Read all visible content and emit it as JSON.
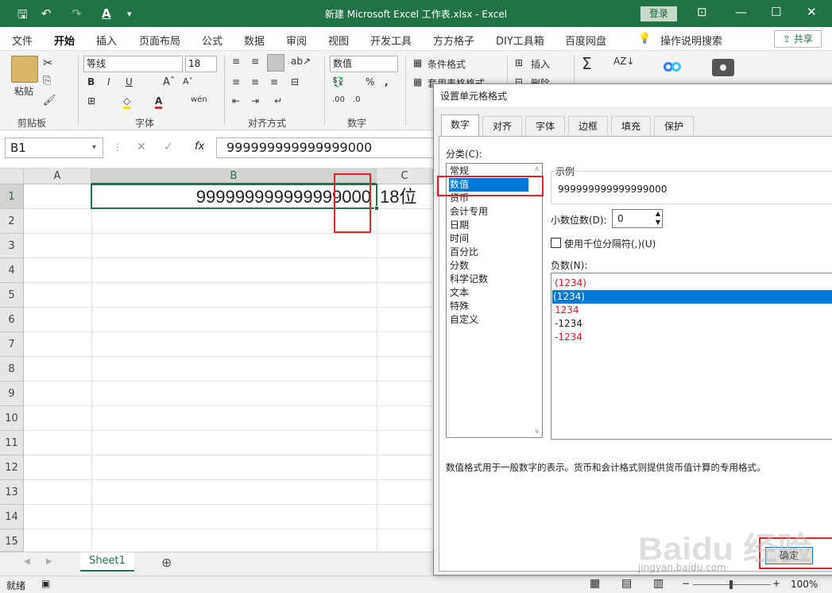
{
  "window": {
    "title": "新建 Microsoft Excel 工作表.xlsx  -  Excel",
    "login": "登录"
  },
  "ribbon_tabs": [
    "文件",
    "开始",
    "插入",
    "页面布局",
    "公式",
    "数据",
    "审阅",
    "视图",
    "开发工具",
    "方方格子",
    "DIY工具箱",
    "百度网盘"
  ],
  "tell_me": "操作说明搜索",
  "share": "共享",
  "ribbon": {
    "clipboard": {
      "paste": "粘贴",
      "group": "剪贴板"
    },
    "font": {
      "name": "等线",
      "size": "18",
      "group": "字体"
    },
    "alignment": {
      "group": "对齐方式"
    },
    "number": {
      "format": "数值",
      "group": "数字"
    },
    "styles": {
      "conditional": "条件格式",
      "table_format": "套用表格格式"
    },
    "cells": {
      "insert": "插入",
      "delete": "删除"
    }
  },
  "formula_bar": {
    "name_box": "B1",
    "content": "999999999999999000"
  },
  "columns": [
    "A",
    "B",
    "C"
  ],
  "rows": [
    "1",
    "2",
    "3",
    "4",
    "5",
    "6",
    "7",
    "8",
    "9",
    "10",
    "11",
    "12",
    "13",
    "14",
    "15"
  ],
  "cells": {
    "B1": "999999999999999000"
  },
  "annotation": "18位",
  "sheet_tab": "Sheet1",
  "status": {
    "ready": "就绪",
    "zoom": "100%"
  },
  "dialog": {
    "title": "设置单元格格式",
    "tabs": [
      "数字",
      "对齐",
      "字体",
      "边框",
      "填充",
      "保护"
    ],
    "category_label": "分类(C):",
    "categories": [
      "常规",
      "数值",
      "货币",
      "会计专用",
      "日期",
      "时间",
      "百分比",
      "分数",
      "科学记数",
      "文本",
      "特殊",
      "自定义"
    ],
    "selected_category": "数值",
    "sample_label": "示例",
    "sample_value": "999999999999999000",
    "decimals_label": "小数位数(D):",
    "decimals_value": "0",
    "thousands_label": "使用千位分隔符(,)(U)",
    "negative_label": "负数(N):",
    "negatives": [
      "(1234)",
      "(1234)",
      "1234",
      "-1234",
      "-1234"
    ],
    "description": "数值格式用于一般数字的表示。货币和会计格式则提供货币值计算的专用格式。",
    "ok": "确定"
  },
  "watermark": {
    "brand": "Baidu 经验",
    "url": "jingyan.baidu.com"
  },
  "colors": {
    "excel_green": "#217346",
    "selection_blue": "#0078d7",
    "highlight_red": "#e8202a",
    "negative_red": "#e81123"
  }
}
